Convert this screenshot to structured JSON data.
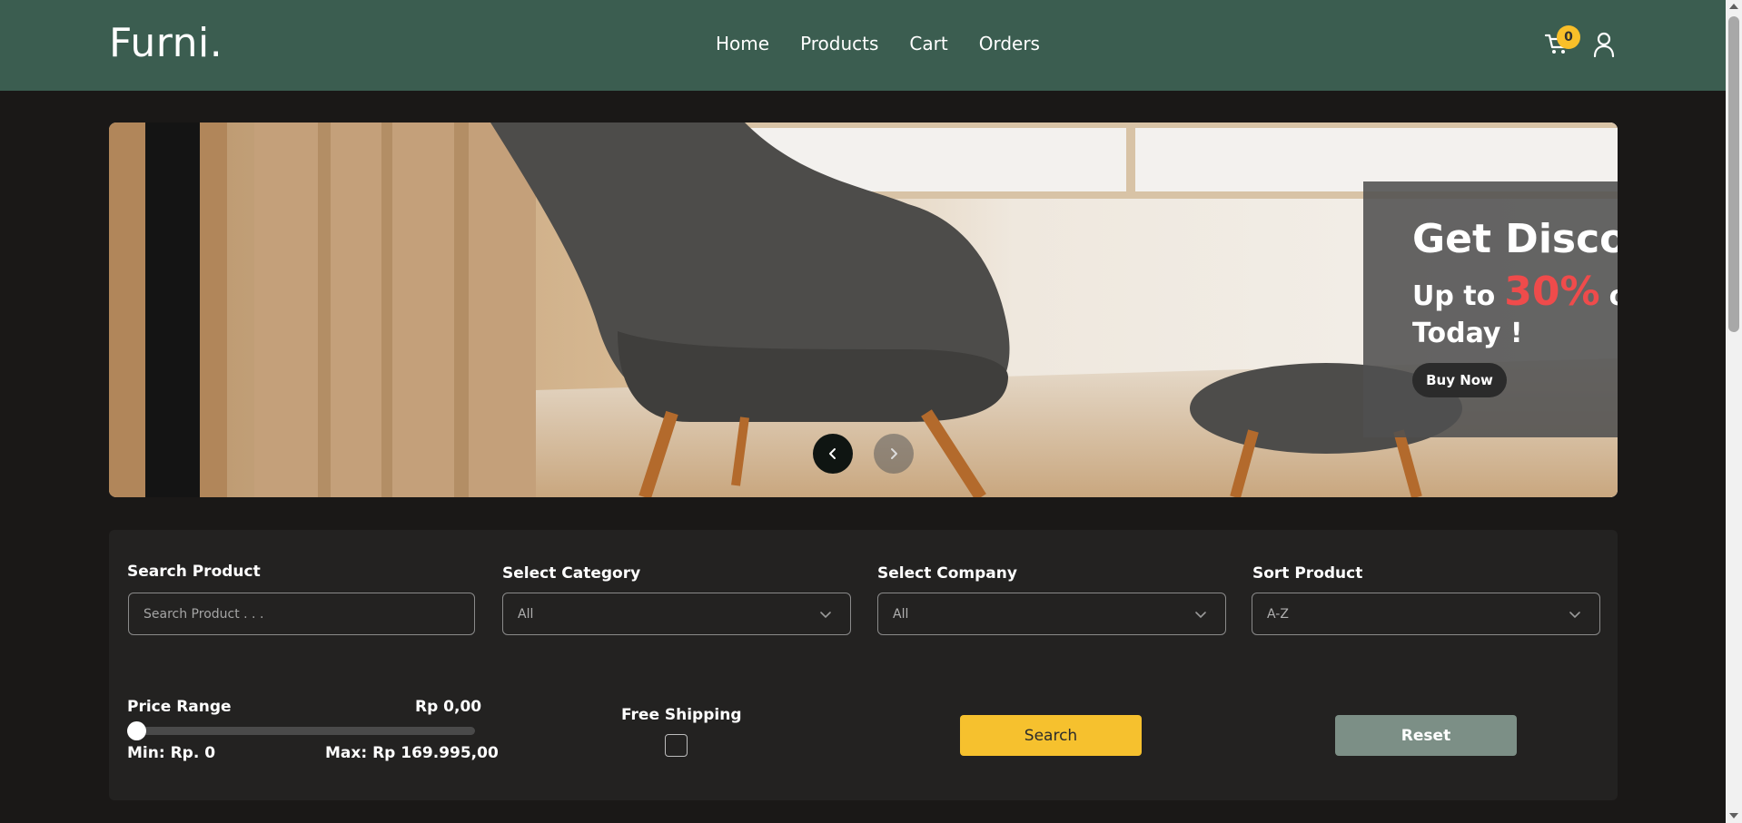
{
  "brand": {
    "logo": "Furni."
  },
  "nav": {
    "links": [
      "Home",
      "Products",
      "Cart",
      "Orders"
    ],
    "cart_count": "0",
    "icons": [
      "cart-icon",
      "user-icon"
    ]
  },
  "hero": {
    "title": "Get Discount",
    "line_prefix": "Up to",
    "percent": "30%",
    "line_suffix": "off",
    "today": "Today !",
    "cta": "Buy Now",
    "accent_color": "#ef4b4b"
  },
  "filters": {
    "search": {
      "label": "Search Product",
      "placeholder": "Search Product . . ."
    },
    "category": {
      "label": "Select Category",
      "value": "All"
    },
    "company": {
      "label": "Select Company",
      "value": "All"
    },
    "sort": {
      "label": "Sort Product",
      "value": "A-Z"
    },
    "price": {
      "label": "Price Range",
      "current": "Rp 0,00",
      "min_label": "Min: Rp. 0",
      "max_label": "Max: Rp 169.995,00",
      "slider_fraction": 0
    },
    "shipping": {
      "label": "Free Shipping",
      "checked": false
    },
    "search_button": "Search",
    "reset_button": "Reset"
  },
  "colors": {
    "navbar": "#3b5d50",
    "background": "#1a1817",
    "panel": "#232221",
    "search_button": "#f6c12e",
    "reset_button": "#7c8f86",
    "badge": "#f9bf29"
  }
}
